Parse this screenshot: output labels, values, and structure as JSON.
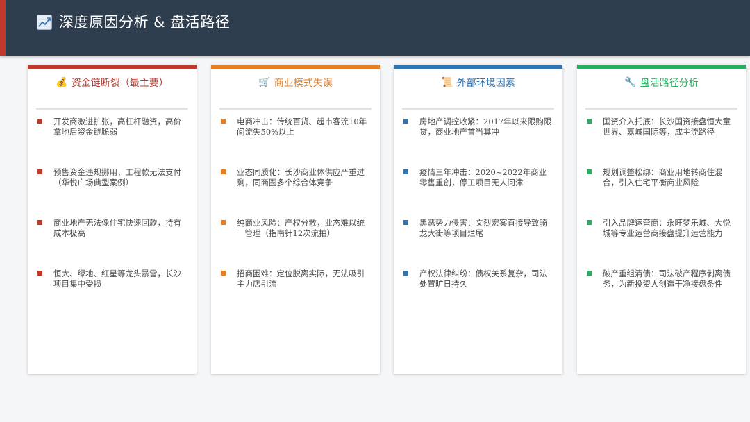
{
  "header": {
    "title": "深度原因分析 & 盘活路径",
    "icon": "chart-icon"
  },
  "cards": [
    {
      "title": "资金链断裂（最主要）",
      "icon": "money-bag-icon",
      "icon_glyph": "💰",
      "color": "#c0392b",
      "title_color": "#b03a2e",
      "items": [
        "开发商激进扩张，高杠杆融资，高价拿地后资金链脆弱",
        "预售资金违规挪用，工程款无法支付（华悦广场典型案例）",
        "商业地产无法像住宅快速回款，持有成本极高",
        "恒大、绿地、红星等龙头暴雷，长沙项目集中受损"
      ]
    },
    {
      "title": "商业模式失误",
      "icon": "shopping-cart-icon",
      "icon_glyph": "🛒",
      "color": "#e67e22",
      "title_color": "#e67e22",
      "items": [
        "电商冲击：传统百货、超市客流10年间流失50%以上",
        "业态同质化：长沙商业体供应严重过剩，同商圈多个综合体竞争",
        "纯商业风险：产权分散，业态难以统一管理（指南针12次流拍）",
        "招商困难：定位脱离实际，无法吸引主力店引流"
      ]
    },
    {
      "title": "外部环境因素",
      "icon": "scroll-icon",
      "icon_glyph": "📜",
      "color": "#2e75b6",
      "title_color": "#2e75b6",
      "items": [
        "房地产调控收紧：2017年以来限购限贷，商业地产首当其冲",
        "疫情三年冲击：2020~2022年商业零售重创，停工项目无人问津",
        "黑恶势力侵害：文烈宏案直接导致骑龙大街等项目烂尾",
        "产权法律纠纷：债权关系复杂，司法处置旷日持久"
      ]
    },
    {
      "title": "盘活路径分析",
      "icon": "wrench-icon",
      "icon_glyph": "🔧",
      "color": "#27ae60",
      "title_color": "#27ae60",
      "items": [
        "国资介入托底：长沙国资接盘恒大童世界、嘉城国际等，成主流路径",
        "规划调整松绑：商业用地转商住混合，引入住宅平衡商业风险",
        "引入品牌运营商：永旺梦乐城、大悦城等专业运营商接盘提升运营能力",
        "破产重组清债：司法破产程序剥离债务，为新投资人创造干净接盘条件"
      ]
    }
  ]
}
